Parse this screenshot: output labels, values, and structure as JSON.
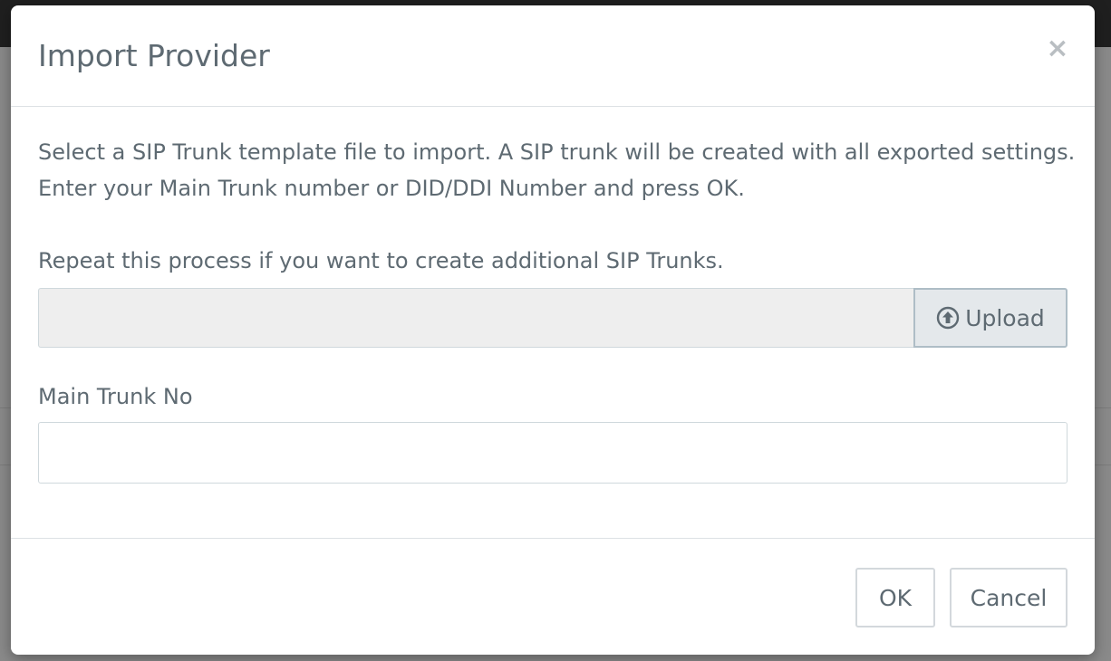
{
  "modal": {
    "title": "Import Provider",
    "close_symbol": "×",
    "description_line1": "Select a SIP Trunk template file to import. A SIP trunk will be created with all exported settings.",
    "description_line2": "Enter your Main Trunk number or DID/DDI Number and press OK.",
    "repeat_note": "Repeat this process if you want to create additional SIP Trunks.",
    "upload": {
      "button_label": "Upload",
      "icon": "upload-circle-arrow-icon",
      "file_value": ""
    },
    "main_trunk": {
      "label": "Main Trunk No",
      "value": "",
      "placeholder": ""
    },
    "footer": {
      "ok_label": "OK",
      "cancel_label": "Cancel"
    }
  },
  "colors": {
    "text": "#5e6a72",
    "border": "#cfd8dc",
    "upload_field_bg": "#eeeeee",
    "upload_button_bg": "#e4e8eb",
    "backdrop": "#8a8a8a",
    "topbar": "#1f1f1f"
  }
}
